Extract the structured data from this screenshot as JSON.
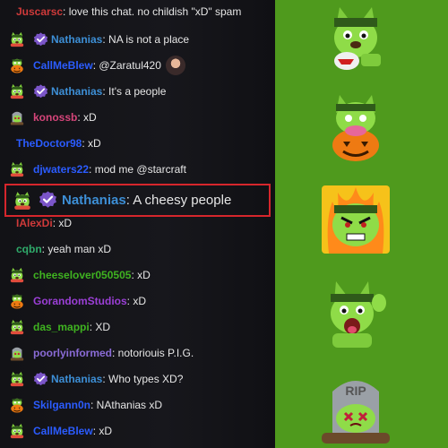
{
  "chat": {
    "messages": [
      {
        "id": "m0",
        "user": "Juscarsc",
        "user_color": "#cf3a3a",
        "text": ": love this chat. no childish \"xD\" spam",
        "icon": null,
        "badge": false
      },
      {
        "id": "m1",
        "user": "Nathanias",
        "user_color": "#3d8fd6",
        "text": ": NA is not a place",
        "icon": "frog-dog-icon",
        "badge": true
      },
      {
        "id": "m2",
        "user": "CallMeBlew",
        "user_color": "#2b5cff",
        "text": ": @Zaratul420",
        "icon": "pumpkin-frog-icon",
        "badge": false,
        "extra": "waving-girl-emote"
      },
      {
        "id": "m3",
        "user": "Nathanias",
        "user_color": "#3d8fd6",
        "text": ": It's a people",
        "icon": "frog-dog-icon",
        "badge": true
      },
      {
        "id": "m4",
        "user": "konossb",
        "user_color": "#d6457a",
        "text": ": xD",
        "icon": "grave-frog-icon",
        "badge": false
      },
      {
        "id": "m5",
        "user": "TheDoctor98",
        "user_color": "#2b5cff",
        "text": ": xD",
        "icon": null,
        "badge": false
      },
      {
        "id": "m6",
        "user": "djwaters22",
        "user_color": "#2b5cff",
        "text": ": mod me @starcraft",
        "icon": "frog-dog-icon",
        "badge": false
      },
      {
        "id": "m7",
        "user": "Nathanias",
        "user_color": "#3d8fd6",
        "text": ": A cheesy people",
        "icon": "frog-dog-icon",
        "badge": true,
        "highlight": true
      },
      {
        "id": "m8",
        "user": "IAlexDi",
        "user_color": "#cf3a3a",
        "text": ": xD",
        "icon": null,
        "badge": false
      },
      {
        "id": "m9",
        "user": "cqbn",
        "user_color": "#2faa6a",
        "text": ": yeah man xD",
        "icon": null,
        "badge": false
      },
      {
        "id": "m10",
        "user": "cheeselover050505",
        "user_color": "#3fb320",
        "text": ": xD",
        "icon": "frog-dog-icon",
        "badge": false
      },
      {
        "id": "m11",
        "user": "GorandomStudios",
        "user_color": "#9b3fd6",
        "text": ": xD",
        "icon": "pumpkin-frog-icon",
        "badge": false
      },
      {
        "id": "m12",
        "user": "das_mappi",
        "user_color": "#3fb320",
        "text": ": XD",
        "icon": "frog-dog-icon",
        "badge": false
      },
      {
        "id": "m13",
        "user": "poorlyinformed",
        "user_color": "#8a6bd6",
        "text": ": notoriouis P.I.G.",
        "icon": "grave-frog-icon",
        "badge": false
      },
      {
        "id": "m14",
        "user": "Nathanias",
        "user_color": "#3d8fd6",
        "text": ": Who types XD?",
        "icon": "frog-dog-icon",
        "badge": true
      },
      {
        "id": "m15",
        "user": "Skilgann0n",
        "user_color": "#2b5cff",
        "text": ": NAthanias xD",
        "icon": "pumpkin-frog-icon",
        "badge": false
      },
      {
        "id": "m16",
        "user": "CallMeBlew",
        "user_color": "#2b5cff",
        "text": ": xD",
        "icon": "frog-dog-icon",
        "badge": false
      }
    ]
  },
  "emotes": [
    {
      "name": "frankendog-spaghetti-emote"
    },
    {
      "name": "frankendog-pumpkin-emote"
    },
    {
      "name": "frankendog-angry-emote"
    },
    {
      "name": "frankendog-waving-emote"
    },
    {
      "name": "frankendog-rip-grave-emote"
    }
  ],
  "colors": {
    "chat_bg": "#141418",
    "emote_panel_bg": "#4f9a1d",
    "highlight_border": "#d6262c",
    "badge_purple": "#7b55c8"
  }
}
